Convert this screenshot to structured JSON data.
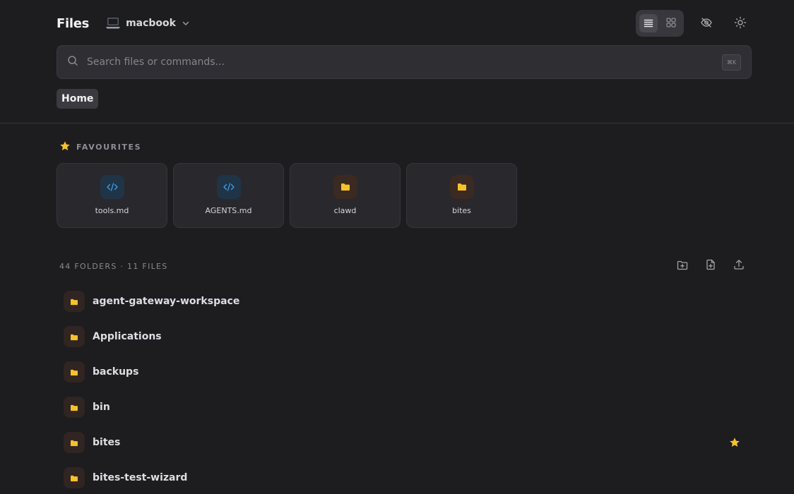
{
  "header": {
    "title": "Files",
    "device": "macbook",
    "icons": [
      "laptop-icon",
      "chevron-down-icon",
      "list-view-icon",
      "grid-view-icon",
      "eye-off-icon",
      "sun-icon"
    ]
  },
  "search": {
    "placeholder": "Search files or commands...",
    "shortcut": "⌘K"
  },
  "breadcrumb": {
    "current": "Home"
  },
  "favourites": {
    "label": "FAVOURITES",
    "items": [
      {
        "name": "tools.md",
        "kind": "code"
      },
      {
        "name": "AGENTS.md",
        "kind": "code"
      },
      {
        "name": "clawd",
        "kind": "folder"
      },
      {
        "name": "bites",
        "kind": "folder"
      }
    ]
  },
  "list": {
    "summary": "44 FOLDERS · 11 FILES",
    "items": [
      {
        "name": "agent-gateway-workspace",
        "starred": false
      },
      {
        "name": "Applications",
        "starred": false
      },
      {
        "name": "backups",
        "starred": false
      },
      {
        "name": "bin",
        "starred": false
      },
      {
        "name": "bites",
        "starred": true
      },
      {
        "name": "bites-test-wizard",
        "starred": false
      }
    ]
  },
  "colors": {
    "background": "#1d1c1f",
    "folder": "#f6c22c",
    "code": "#3aa0ea",
    "star": "#f6c22c"
  }
}
